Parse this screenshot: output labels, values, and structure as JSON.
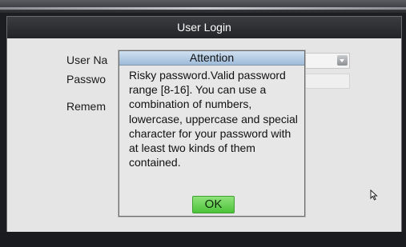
{
  "login": {
    "title": "User Login",
    "username_label": "User Na",
    "password_label": "Passwo",
    "remember_label": "Remem"
  },
  "dialog": {
    "title": "Attention",
    "message": "Risky password.Valid password range [8-16]. You can use a combination of numbers, lowercase, uppercase and special character for your password with at least two kinds of them contained.",
    "ok_label": "OK"
  },
  "colors": {
    "titlebar_bg": "#2b2c30",
    "dialog_title_bg": "#b6cde4",
    "ok_button_bg": "#6ad556",
    "window_bg": "#e5e5e5"
  },
  "icons": {
    "dropdown": "chevron-down-icon",
    "cursor": "mouse-pointer-icon"
  }
}
